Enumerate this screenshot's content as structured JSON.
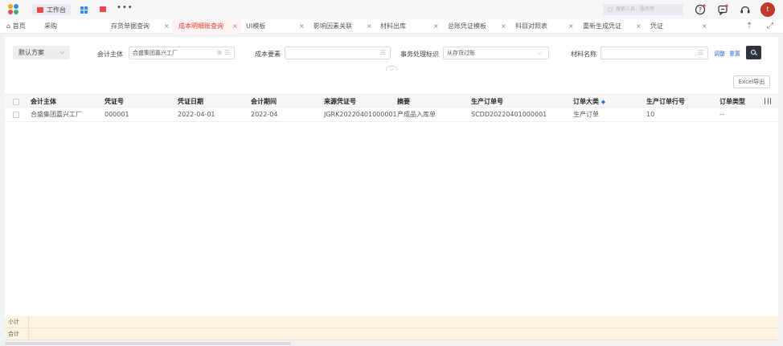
{
  "topbar": {
    "workspace_label": "工作台",
    "more_label": "•••",
    "search_placeholder": "搜索人员、服务等",
    "avatar_initial": "t",
    "colors": {
      "brand_red": "#e94a4a",
      "accent_blue": "#2f8cf0",
      "avatar": "#c0392b"
    },
    "icons": [
      "app-logo-icon",
      "workbench-icon",
      "apps-grid-icon",
      "app-red-icon",
      "search-icon",
      "help-icon",
      "message-icon",
      "headset-icon"
    ]
  },
  "tabs": [
    {
      "label": "首页",
      "icon": "home-icon",
      "closable": false,
      "active": false
    },
    {
      "label": "采购",
      "closable": false,
      "active": false
    },
    {
      "label": "存货单据查询",
      "closable": true,
      "active": false
    },
    {
      "label": "成本明细账查询",
      "closable": true,
      "active": true
    },
    {
      "label": "UI模板",
      "closable": true,
      "active": false
    },
    {
      "label": "影响因素关联",
      "closable": true,
      "active": false
    },
    {
      "label": "材料出库",
      "closable": true,
      "active": false
    },
    {
      "label": "总账凭证模板",
      "closable": true,
      "active": false
    },
    {
      "label": "科目对照表",
      "closable": true,
      "active": false
    },
    {
      "label": "重新生成凭证",
      "closable": true,
      "active": false
    },
    {
      "label": "凭证",
      "closable": true,
      "active": false
    }
  ],
  "tab_close": "×",
  "filters": {
    "scheme_label": "默认方案",
    "entity_label": "会计主体",
    "entity_value": "合盛集团嘉兴工厂",
    "cost_element_label": "成本要素",
    "cost_element_value": "",
    "process_flag_label": "事务处理标识",
    "process_flag_value": "从存货过账",
    "material_label": "材料名称",
    "material_value": "",
    "adjust_label": "调整",
    "reset_label": "重置"
  },
  "toolbar": {
    "excel_label": "Excel导出"
  },
  "table": {
    "columns": [
      "会计主体",
      "凭证号",
      "凭证日期",
      "会计期间",
      "来源凭证号",
      "摘要",
      "生产订单号",
      "订单大类",
      "生产订单行号",
      "订单类型"
    ],
    "sort_column": "订单大类",
    "rows": [
      [
        "合盛集团嘉兴工厂",
        "000001",
        "2022-04-01",
        "2022-04",
        "JGRK20220401000001",
        "产成品入库单",
        "SCDD20220401000001",
        "生产订单",
        "10",
        "--"
      ]
    ]
  },
  "summary": {
    "subtotal_label": "小计",
    "total_label": "合计",
    "color": "#fdf3e1"
  }
}
